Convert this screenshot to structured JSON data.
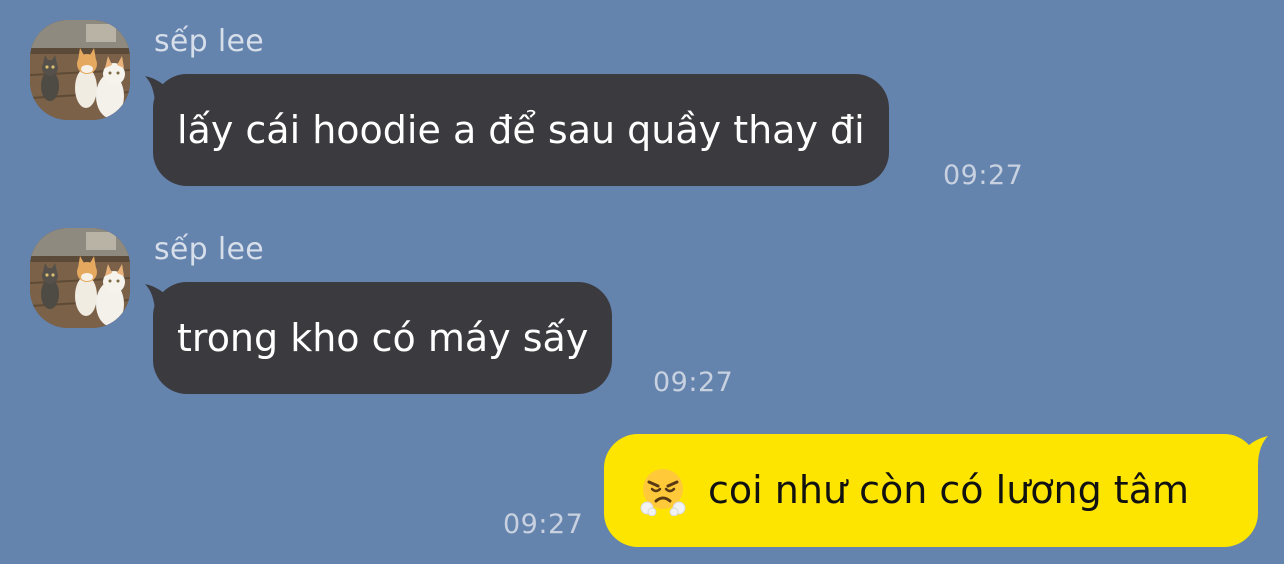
{
  "conversation": {
    "messages": [
      {
        "direction": "incoming",
        "sender": "sếp lee",
        "text": "lấy cái hoodie a để sau quầy thay đi",
        "time": "09:27",
        "avatar": "cat-photo-avatar"
      },
      {
        "direction": "incoming",
        "sender": "sếp lee",
        "text": "trong kho có máy sấy",
        "time": "09:27",
        "avatar": "cat-photo-avatar"
      },
      {
        "direction": "outgoing",
        "text": "coi như còn có lương tâm",
        "time": "09:27",
        "emoji": "face-with-steam-from-nose"
      }
    ]
  },
  "colors": {
    "background": "#6483ad",
    "incoming_bubble": "#3b3b3f",
    "outgoing_bubble": "#fde500",
    "sender_name": "#d6deea",
    "timestamp": "#c7d1e0"
  }
}
